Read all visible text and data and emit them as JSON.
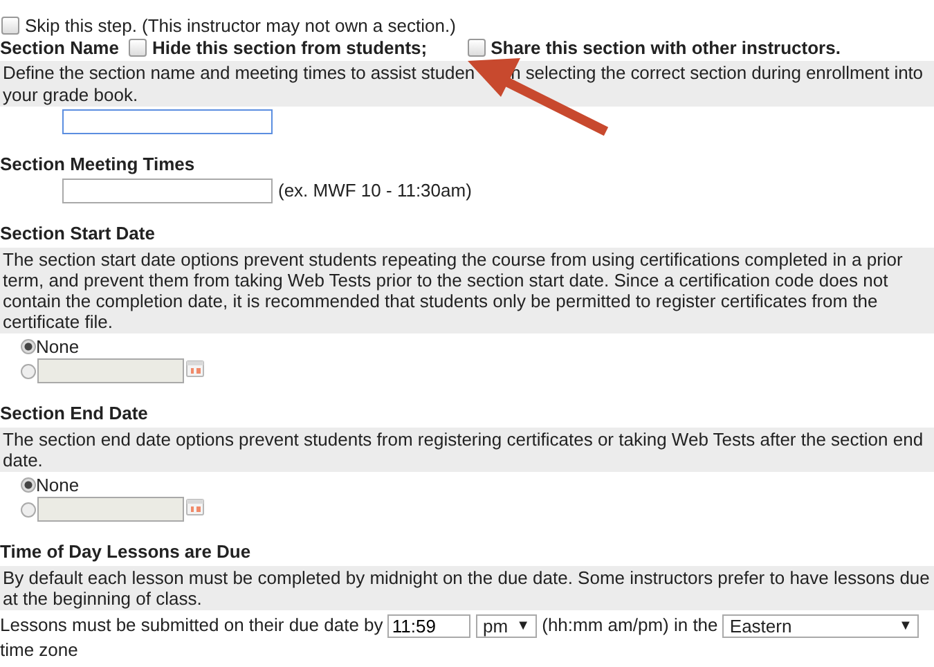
{
  "skip": {
    "label": "Skip this step. (This instructor may not own a section.)",
    "checked": false
  },
  "section_name": {
    "title": "Section Name",
    "options": [
      {
        "label": "Hide this section from students;",
        "checked": false
      },
      {
        "label": "Share this section with other instructors.",
        "checked": false
      }
    ],
    "description_parts": [
      "Define the section name and meeting times to assist studen",
      "n selecting the correct section during enrollment into",
      "your grade book."
    ],
    "input": {
      "focused": true
    }
  },
  "meeting_times": {
    "title": "Section Meeting Times",
    "hint": "(ex. MWF 10 - 11:30am)"
  },
  "date_sections": [
    {
      "title": "Section Start Date",
      "description": "The section start date options prevent students repeating the course from using certifications completed in a prior term, and prevent them from taking Web Tests prior to the section start date. Since a certification code does not contain the completion date, it is recommended that students only be permitted to register certificates from the certificate file.",
      "options": [
        {
          "kind": "none",
          "label": "None",
          "selected": true
        },
        {
          "kind": "date",
          "selected": false,
          "disabled": true
        }
      ]
    },
    {
      "title": "Section End Date",
      "description": "The section end date options prevent students from registering certificates or taking Web Tests after the section end date.",
      "options": [
        {
          "kind": "none",
          "label": "None",
          "selected": true
        },
        {
          "kind": "date",
          "selected": false,
          "disabled": true
        }
      ]
    }
  ],
  "due_time": {
    "title": "Time of Day Lessons are Due",
    "description": "By default each lesson must be completed by midnight on the due date. Some instructors prefer to have lessons due at the beginning of class.",
    "parts": [
      {
        "kind": "text",
        "text": "Lessons must be submitted on their due date by"
      },
      {
        "kind": "input",
        "value": "11:59"
      },
      {
        "kind": "select",
        "value": "pm",
        "caret": "▼"
      },
      {
        "kind": "text",
        "text": "(hh:mm am/pm) in the"
      },
      {
        "kind": "select",
        "value": "Eastern",
        "caret": "▼"
      },
      {
        "kind": "text",
        "text": "time zone"
      }
    ]
  }
}
